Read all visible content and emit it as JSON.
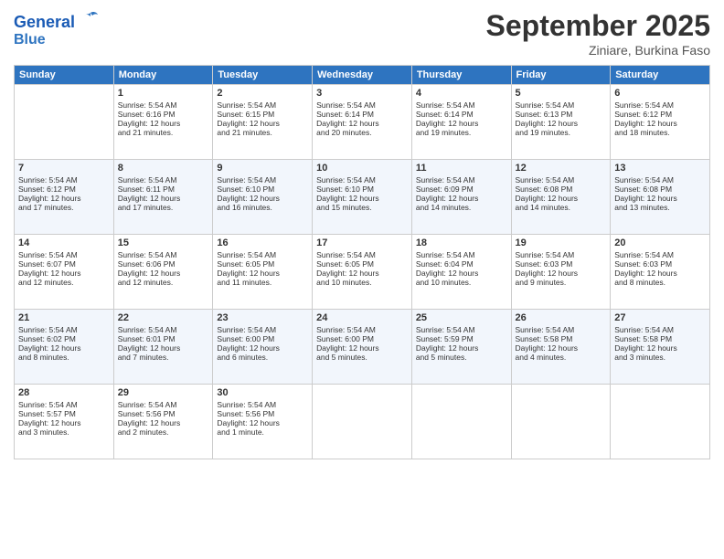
{
  "header": {
    "logo_line1": "General",
    "logo_line2": "Blue",
    "month": "September 2025",
    "location": "Ziniare, Burkina Faso"
  },
  "weekdays": [
    "Sunday",
    "Monday",
    "Tuesday",
    "Wednesday",
    "Thursday",
    "Friday",
    "Saturday"
  ],
  "weeks": [
    [
      {
        "day": "",
        "info": ""
      },
      {
        "day": "1",
        "info": "Sunrise: 5:54 AM\nSunset: 6:16 PM\nDaylight: 12 hours\nand 21 minutes."
      },
      {
        "day": "2",
        "info": "Sunrise: 5:54 AM\nSunset: 6:15 PM\nDaylight: 12 hours\nand 21 minutes."
      },
      {
        "day": "3",
        "info": "Sunrise: 5:54 AM\nSunset: 6:14 PM\nDaylight: 12 hours\nand 20 minutes."
      },
      {
        "day": "4",
        "info": "Sunrise: 5:54 AM\nSunset: 6:14 PM\nDaylight: 12 hours\nand 19 minutes."
      },
      {
        "day": "5",
        "info": "Sunrise: 5:54 AM\nSunset: 6:13 PM\nDaylight: 12 hours\nand 19 minutes."
      },
      {
        "day": "6",
        "info": "Sunrise: 5:54 AM\nSunset: 6:12 PM\nDaylight: 12 hours\nand 18 minutes."
      }
    ],
    [
      {
        "day": "7",
        "info": "Sunrise: 5:54 AM\nSunset: 6:12 PM\nDaylight: 12 hours\nand 17 minutes."
      },
      {
        "day": "8",
        "info": "Sunrise: 5:54 AM\nSunset: 6:11 PM\nDaylight: 12 hours\nand 17 minutes."
      },
      {
        "day": "9",
        "info": "Sunrise: 5:54 AM\nSunset: 6:10 PM\nDaylight: 12 hours\nand 16 minutes."
      },
      {
        "day": "10",
        "info": "Sunrise: 5:54 AM\nSunset: 6:10 PM\nDaylight: 12 hours\nand 15 minutes."
      },
      {
        "day": "11",
        "info": "Sunrise: 5:54 AM\nSunset: 6:09 PM\nDaylight: 12 hours\nand 14 minutes."
      },
      {
        "day": "12",
        "info": "Sunrise: 5:54 AM\nSunset: 6:08 PM\nDaylight: 12 hours\nand 14 minutes."
      },
      {
        "day": "13",
        "info": "Sunrise: 5:54 AM\nSunset: 6:08 PM\nDaylight: 12 hours\nand 13 minutes."
      }
    ],
    [
      {
        "day": "14",
        "info": "Sunrise: 5:54 AM\nSunset: 6:07 PM\nDaylight: 12 hours\nand 12 minutes."
      },
      {
        "day": "15",
        "info": "Sunrise: 5:54 AM\nSunset: 6:06 PM\nDaylight: 12 hours\nand 12 minutes."
      },
      {
        "day": "16",
        "info": "Sunrise: 5:54 AM\nSunset: 6:05 PM\nDaylight: 12 hours\nand 11 minutes."
      },
      {
        "day": "17",
        "info": "Sunrise: 5:54 AM\nSunset: 6:05 PM\nDaylight: 12 hours\nand 10 minutes."
      },
      {
        "day": "18",
        "info": "Sunrise: 5:54 AM\nSunset: 6:04 PM\nDaylight: 12 hours\nand 10 minutes."
      },
      {
        "day": "19",
        "info": "Sunrise: 5:54 AM\nSunset: 6:03 PM\nDaylight: 12 hours\nand 9 minutes."
      },
      {
        "day": "20",
        "info": "Sunrise: 5:54 AM\nSunset: 6:03 PM\nDaylight: 12 hours\nand 8 minutes."
      }
    ],
    [
      {
        "day": "21",
        "info": "Sunrise: 5:54 AM\nSunset: 6:02 PM\nDaylight: 12 hours\nand 8 minutes."
      },
      {
        "day": "22",
        "info": "Sunrise: 5:54 AM\nSunset: 6:01 PM\nDaylight: 12 hours\nand 7 minutes."
      },
      {
        "day": "23",
        "info": "Sunrise: 5:54 AM\nSunset: 6:00 PM\nDaylight: 12 hours\nand 6 minutes."
      },
      {
        "day": "24",
        "info": "Sunrise: 5:54 AM\nSunset: 6:00 PM\nDaylight: 12 hours\nand 5 minutes."
      },
      {
        "day": "25",
        "info": "Sunrise: 5:54 AM\nSunset: 5:59 PM\nDaylight: 12 hours\nand 5 minutes."
      },
      {
        "day": "26",
        "info": "Sunrise: 5:54 AM\nSunset: 5:58 PM\nDaylight: 12 hours\nand 4 minutes."
      },
      {
        "day": "27",
        "info": "Sunrise: 5:54 AM\nSunset: 5:58 PM\nDaylight: 12 hours\nand 3 minutes."
      }
    ],
    [
      {
        "day": "28",
        "info": "Sunrise: 5:54 AM\nSunset: 5:57 PM\nDaylight: 12 hours\nand 3 minutes."
      },
      {
        "day": "29",
        "info": "Sunrise: 5:54 AM\nSunset: 5:56 PM\nDaylight: 12 hours\nand 2 minutes."
      },
      {
        "day": "30",
        "info": "Sunrise: 5:54 AM\nSunset: 5:56 PM\nDaylight: 12 hours\nand 1 minute."
      },
      {
        "day": "",
        "info": ""
      },
      {
        "day": "",
        "info": ""
      },
      {
        "day": "",
        "info": ""
      },
      {
        "day": "",
        "info": ""
      }
    ]
  ]
}
